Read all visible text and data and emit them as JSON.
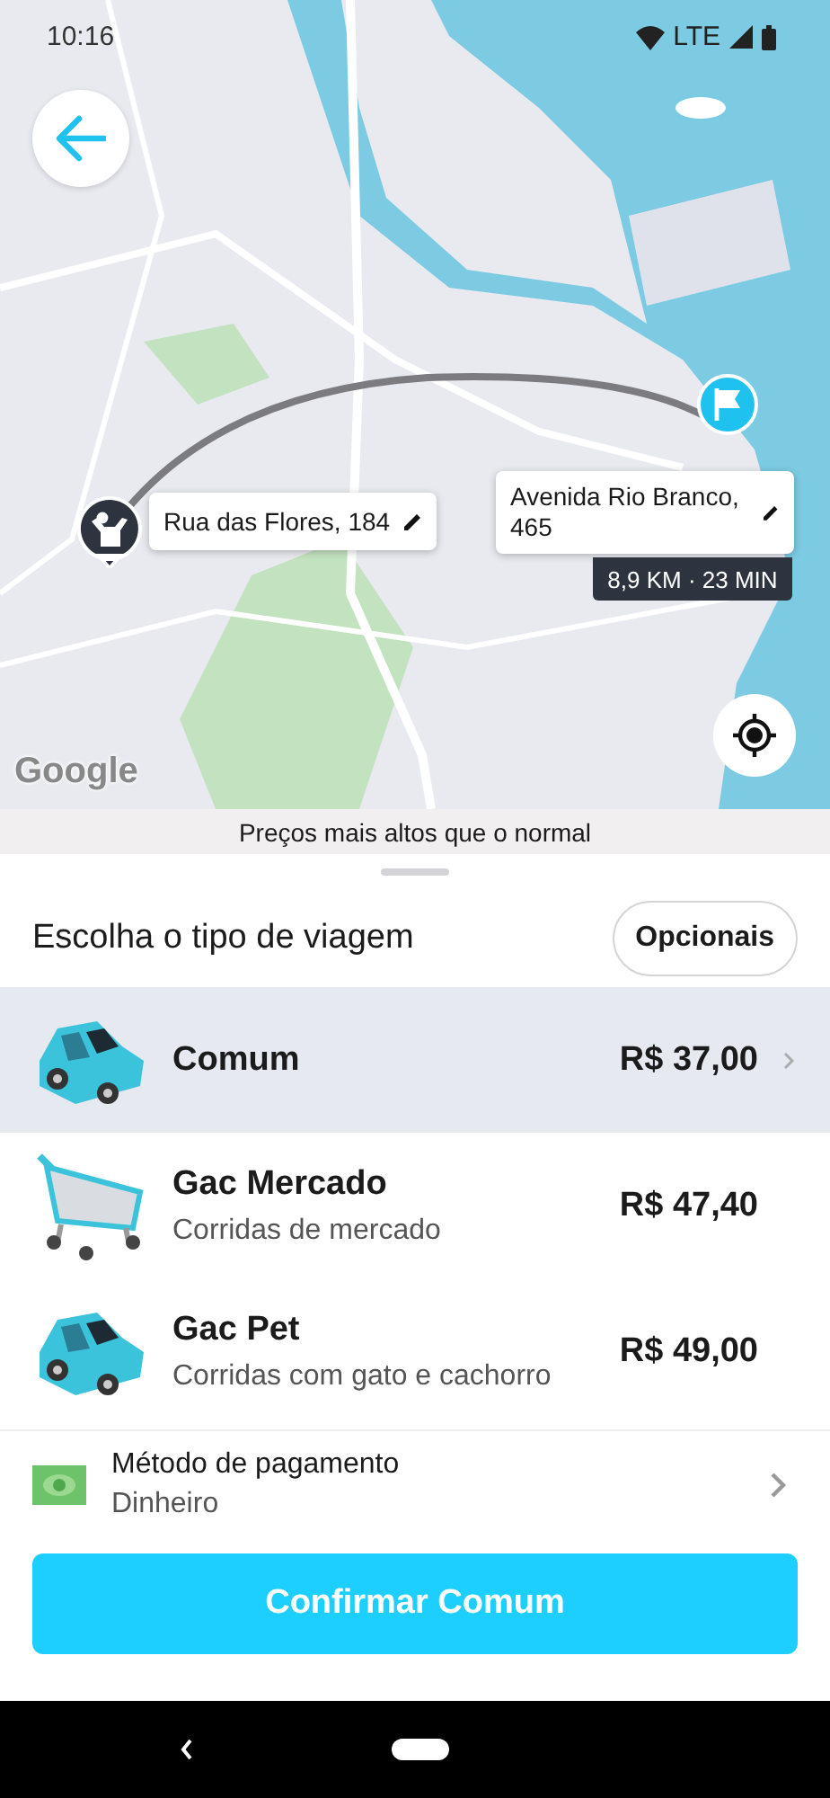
{
  "status_bar": {
    "time": "10:16",
    "network": "LTE"
  },
  "map": {
    "origin": {
      "label": "Rua das Flores, 184"
    },
    "destination": {
      "label": "Avenida Rio Branco, 465"
    },
    "route_info": "8,9 KM · 23 MIN",
    "attribution": "Google"
  },
  "notice": "Preços mais altos que o normal",
  "header": {
    "title": "Escolha o tipo de viagem",
    "options_button": "Opcionais"
  },
  "ride_options": [
    {
      "kind": "car",
      "name": "Comum",
      "price": "R$ 37,00",
      "selected": true
    },
    {
      "kind": "cart",
      "name": "Gac Mercado",
      "description": "Corridas de mercado",
      "price": "R$ 47,40",
      "selected": false
    },
    {
      "kind": "car",
      "name": "Gac Pet",
      "description": "Corridas com gato e cachorro",
      "price": "R$ 49,00",
      "selected": false
    }
  ],
  "payment": {
    "label": "Método de pagamento",
    "value": "Dinheiro"
  },
  "confirm_button": "Confirmar Comum"
}
